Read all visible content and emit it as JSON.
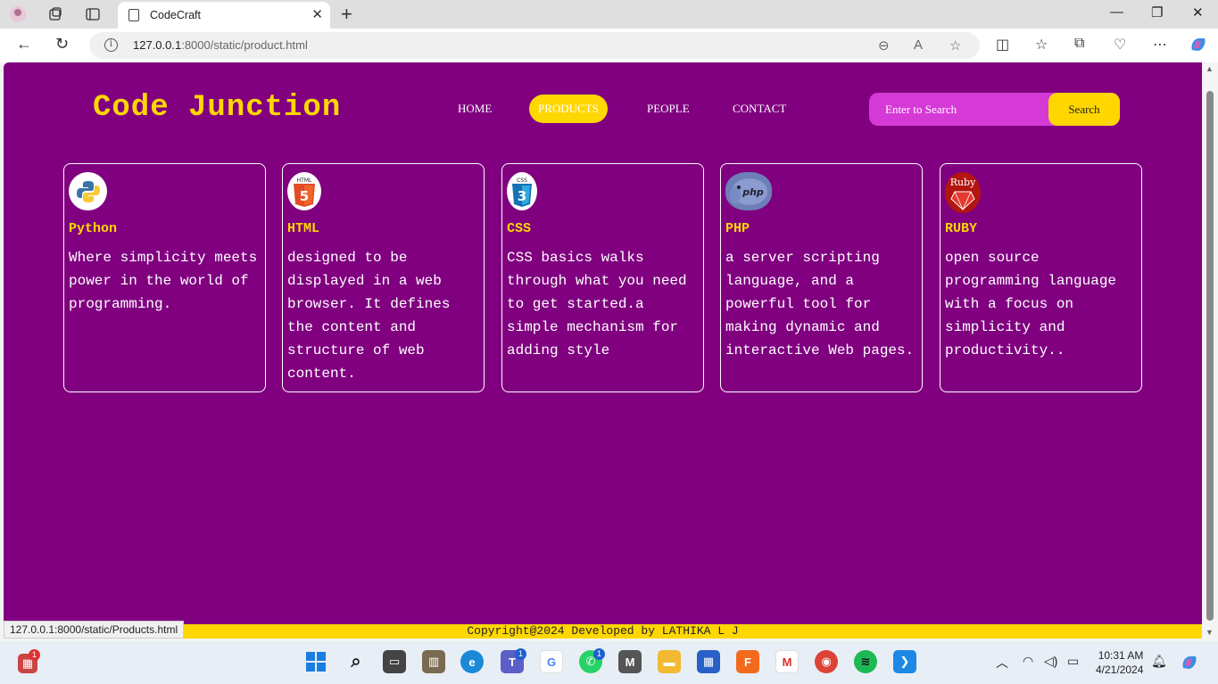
{
  "browser": {
    "tab_title": "CodeCraft",
    "url_host": "127.0.0.1",
    "url_rest": ":8000/static/product.html",
    "status_url": "127.0.0.1:8000/static/Products.html"
  },
  "site": {
    "logo": "Code Junction",
    "nav": [
      "HOME",
      "PRODUCTS",
      "PEOPLE",
      "CONTACT"
    ],
    "active_nav": "PRODUCTS",
    "search_placeholder": "Enter to Search",
    "search_button": "Search",
    "footer": "Copyright@2024 Developed by LATHIKA L J"
  },
  "products": [
    {
      "name": "Python",
      "desc": "Where simplicity meets power in the world of programming.",
      "icon": "python-logo-icon"
    },
    {
      "name": "HTML",
      "desc": "designed to be displayed in a web browser. It defines the content and structure of web content.",
      "icon": "html5-logo-icon"
    },
    {
      "name": "CSS",
      "desc": "CSS basics walks through what you need to get started.a simple mechanism for adding style",
      "icon": "css3-logo-icon"
    },
    {
      "name": "PHP",
      "desc": "a server scripting language, and a powerful tool for making dynamic and interactive Web pages.",
      "icon": "php-elephant-icon"
    },
    {
      "name": "RUBY",
      "desc": "open source programming language with a focus on simplicity and productivity..",
      "icon": "ruby-logo-icon"
    }
  ],
  "taskbar": {
    "time": "10:31 AM",
    "date": "4/21/2024",
    "notification_count": "1",
    "teams_badge": "1",
    "whatsapp_badge": "1"
  },
  "colors": {
    "page_bg": "#800080",
    "accent": "#ffd700",
    "search_bg": "#d63ad6"
  }
}
